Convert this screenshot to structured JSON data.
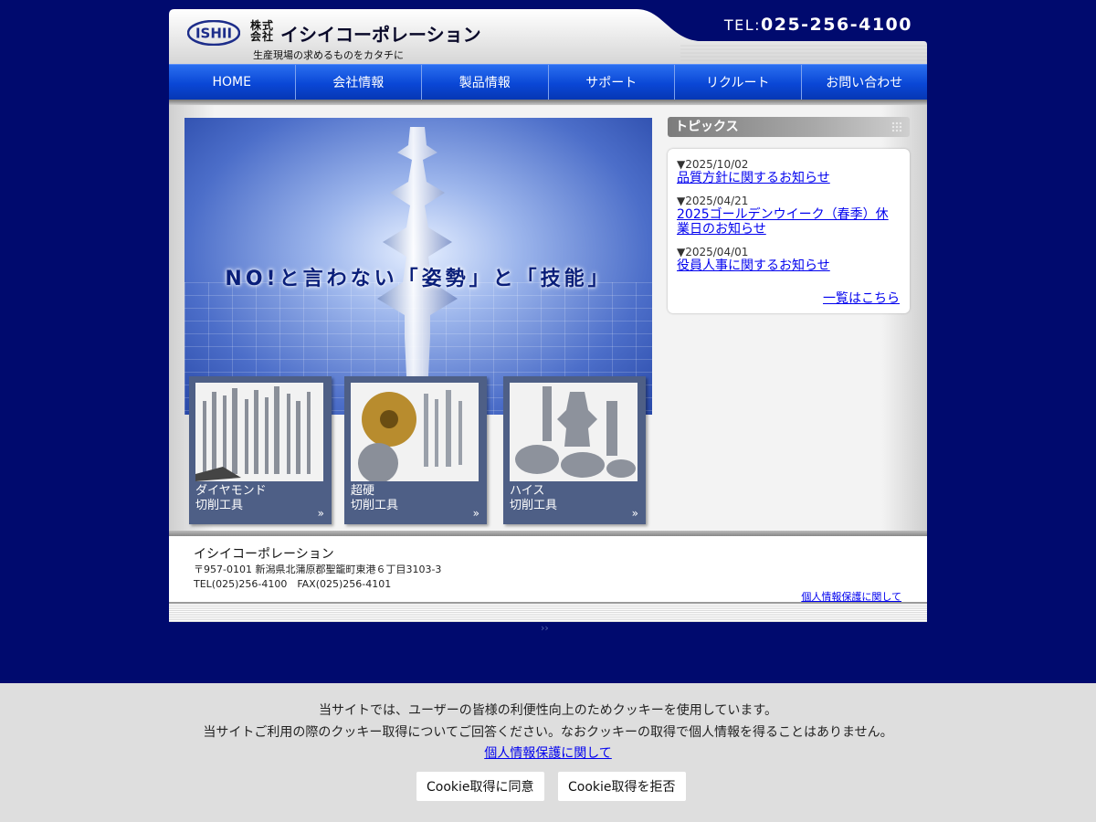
{
  "header": {
    "logo_mark": "ISHII",
    "logo_kabu": "株式会社",
    "company_name": "イシイコーポレーション",
    "tagline": "生産現場の求めるものをカタチに",
    "tel_prefix": "TEL:",
    "tel_number": "025-256-4100"
  },
  "nav": {
    "items": [
      {
        "label": "HOME"
      },
      {
        "label": "会社情報"
      },
      {
        "label": "製品情報"
      },
      {
        "label": "サポート"
      },
      {
        "label": "リクルート"
      },
      {
        "label": "お問い合わせ"
      }
    ]
  },
  "hero": {
    "copy": "NO!と言わない「姿勢」と「技能」"
  },
  "cards": [
    {
      "label": "ダイヤモンド\n切削工具",
      "icon": "double-chevron-right-icon"
    },
    {
      "label": "超硬\n切削工具",
      "icon": "double-chevron-right-icon"
    },
    {
      "label": "ハイス\n切削工具",
      "icon": "double-chevron-right-icon"
    }
  ],
  "topics": {
    "title": "トピックス",
    "items": [
      {
        "date": "▼2025/10/02",
        "title": "品質方針に関するお知らせ"
      },
      {
        "date": "▼2025/04/21",
        "title": "2025ゴールデンウイーク（春季）休業日のお知らせ"
      },
      {
        "date": "▼2025/04/01",
        "title": "役員人事に関するお知らせ"
      }
    ],
    "more": "一覧はこちら"
  },
  "footer": {
    "company": "イシイコーポレーション",
    "address": "〒957-0101 新潟県北蒲原郡聖籠町東港６丁目3103-3",
    "tel_fax": "TEL(025)256-4100　FAX(025)256-4101",
    "privacy": "個人情報保護に関して"
  },
  "cookie": {
    "line1": "当サイトでは、ユーザーの皆様の利便性向上のためクッキーを使用しています。",
    "line2": "当サイトご利用の際のクッキー取得についてご回答ください。なおクッキーの取得で個人情報を得ることはありません。",
    "privacy_link": "個人情報保護に関して",
    "accept": "Cookie取得に同意",
    "reject": "Cookie取得を拒否"
  },
  "colors": {
    "page_bg": "#000a6e",
    "nav_blue": "#0a47d6",
    "link": "#0000ee",
    "card_bg": "#4e5f86"
  }
}
